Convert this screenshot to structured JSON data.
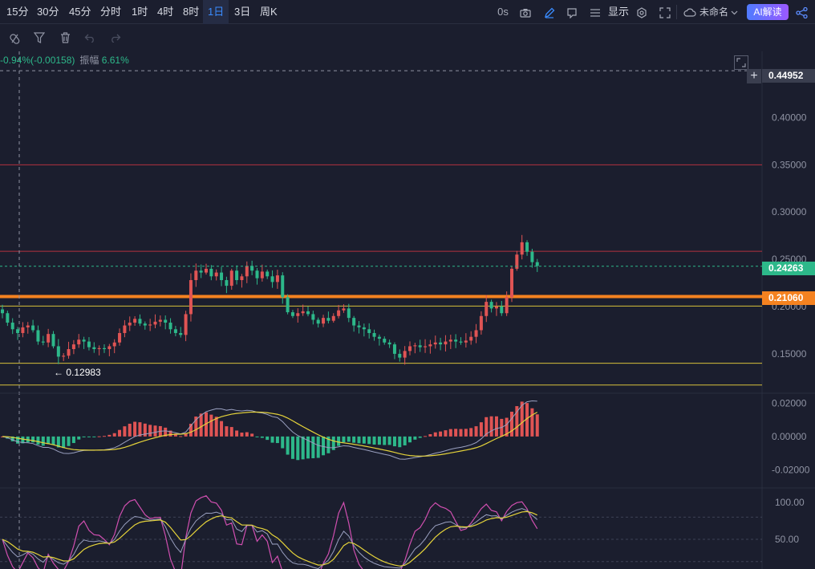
{
  "toolbar": {
    "timeframes": [
      "15分",
      "30分",
      "45分",
      "分时",
      "1时",
      "4时",
      "8时",
      "1日",
      "3日",
      "周K"
    ],
    "active_timeframe": "1日",
    "countdown": "0s",
    "display_label": "显示",
    "workspace_name": "未命名",
    "ai_button": "AI解读",
    "icons": [
      "camera-icon",
      "pencil-icon",
      "frame-icon",
      "menu-icon",
      "settings-icon",
      "fullscreen-icon",
      "cloud-icon",
      "chevron-down-icon",
      "share-icon"
    ]
  },
  "drawing_tools": [
    "magnet-icon",
    "filter-icon",
    "trash-icon",
    "undo-icon",
    "redo-icon"
  ],
  "info": {
    "change": "-0.94%(-0.00158)",
    "amplitude_label": "振幅",
    "amplitude_value": "6.61%"
  },
  "price_tags": {
    "crosshair": "0.44952",
    "last": "0.24263",
    "line": "0.21060"
  },
  "low_annotation": "← 0.12983",
  "colors": {
    "up": "#e05454",
    "down": "#2db88a",
    "highlight_line": "#f58220",
    "yellow_line": "#d8c03a",
    "red_line": "#b3313f",
    "background": "#1b1e2e"
  },
  "chart_data": [
    {
      "type": "candlestick",
      "y_axis_ticks": [
        "0.40000",
        "0.35000",
        "0.30000",
        "0.25000",
        "0.20000",
        "0.15000"
      ],
      "ylim": [
        0.11,
        0.47
      ],
      "horizontal_lines": [
        {
          "value": 0.35,
          "color": "#b3313f"
        },
        {
          "value": 0.2585,
          "color": "#b3313f"
        },
        {
          "value": 0.2106,
          "color": "#f58220"
        },
        {
          "value": 0.2005,
          "color": "#d8c03a"
        },
        {
          "value": 0.14,
          "color": "#d8c03a"
        },
        {
          "value": 0.117,
          "color": "#d8c03a"
        }
      ],
      "closes": [
        0.193,
        0.183,
        0.176,
        0.172,
        0.178,
        0.18,
        0.175,
        0.163,
        0.162,
        0.171,
        0.158,
        0.147,
        0.148,
        0.155,
        0.16,
        0.165,
        0.163,
        0.157,
        0.155,
        0.156,
        0.155,
        0.158,
        0.162,
        0.172,
        0.18,
        0.183,
        0.187,
        0.182,
        0.18,
        0.181,
        0.184,
        0.186,
        0.183,
        0.176,
        0.172,
        0.17,
        0.192,
        0.228,
        0.238,
        0.236,
        0.24,
        0.232,
        0.236,
        0.228,
        0.222,
        0.238,
        0.228,
        0.232,
        0.243,
        0.238,
        0.23,
        0.237,
        0.232,
        0.226,
        0.233,
        0.21,
        0.194,
        0.19,
        0.193,
        0.195,
        0.192,
        0.186,
        0.182,
        0.188,
        0.185,
        0.19,
        0.196,
        0.198,
        0.188,
        0.18,
        0.178,
        0.176,
        0.172,
        0.168,
        0.166,
        0.162,
        0.16,
        0.15,
        0.146,
        0.153,
        0.158,
        0.159,
        0.157,
        0.158,
        0.16,
        0.162,
        0.16,
        0.163,
        0.165,
        0.163,
        0.162,
        0.164,
        0.168,
        0.175,
        0.19,
        0.205,
        0.198,
        0.2,
        0.193,
        0.21,
        0.24,
        0.255,
        0.268,
        0.258,
        0.247,
        0.243
      ],
      "min_label": "0.12983"
    },
    {
      "type": "macd",
      "y_axis_ticks": [
        "0.02000",
        "0.00000",
        "-0.02000"
      ],
      "ylim": [
        -0.027,
        0.024
      ]
    },
    {
      "type": "line",
      "y_axis_ticks": [
        "100.00",
        "50.00"
      ],
      "ylim": [
        10,
        115
      ],
      "reference_lines": [
        80,
        50,
        20
      ]
    }
  ]
}
